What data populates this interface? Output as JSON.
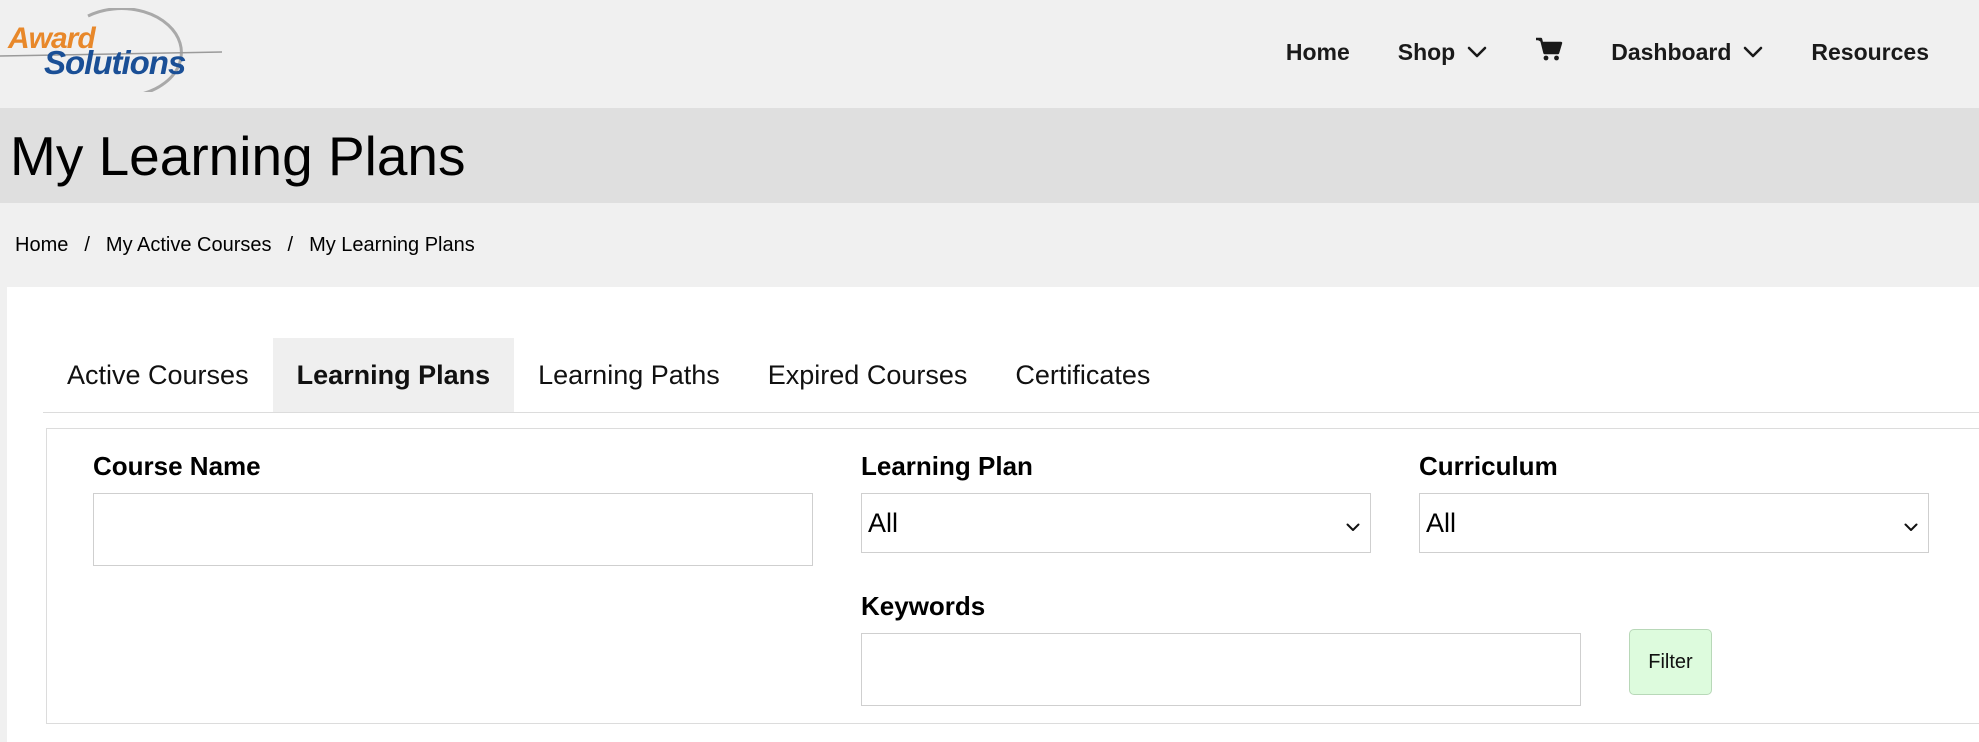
{
  "logo": {
    "word1": "Award",
    "word2": "Solutions"
  },
  "nav": {
    "home": "Home",
    "shop": "Shop",
    "cart_icon": "shopping-cart-icon",
    "dashboard": "Dashboard",
    "resources": "Resources"
  },
  "page": {
    "title": "My Learning Plans"
  },
  "breadcrumb": {
    "items": [
      "Home",
      "My Active Courses",
      "My Learning Plans"
    ],
    "separator": "/"
  },
  "tabs": [
    {
      "label": "Active Courses",
      "active": false
    },
    {
      "label": "Learning Plans",
      "active": true
    },
    {
      "label": "Learning Paths",
      "active": false
    },
    {
      "label": "Expired Courses",
      "active": false
    },
    {
      "label": "Certificates",
      "active": false
    }
  ],
  "filters": {
    "course_name": {
      "label": "Course Name",
      "value": ""
    },
    "learning_plan": {
      "label": "Learning Plan",
      "selected": "All"
    },
    "curriculum": {
      "label": "Curriculum",
      "selected": "All"
    },
    "keywords": {
      "label": "Keywords",
      "value": ""
    },
    "filter_button": "Filter"
  },
  "colors": {
    "logo_orange": "#e8882a",
    "logo_blue": "#1a4f96",
    "filter_button_bg": "#ddfbdd",
    "title_band": "#dfdfdf",
    "page_bg": "#f0f0f0"
  }
}
